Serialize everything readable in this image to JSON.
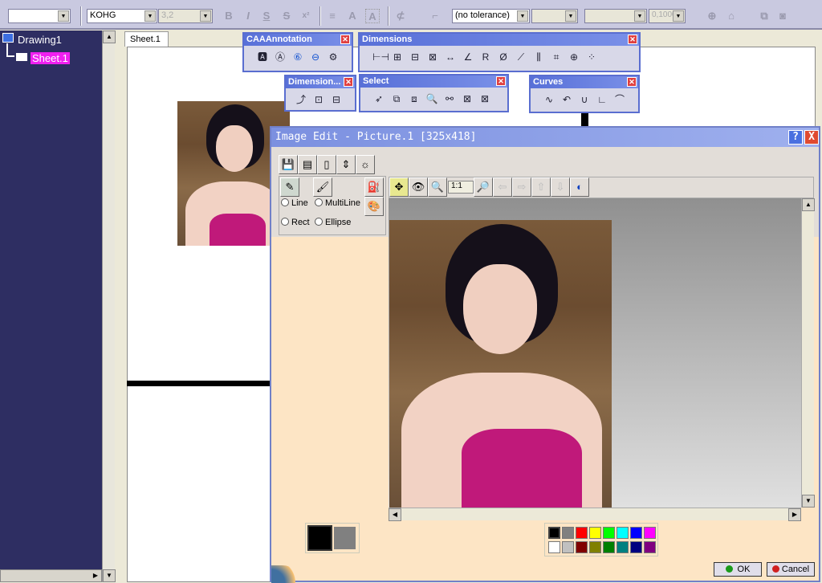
{
  "toolbar": {
    "font_name": "KOHG",
    "font_size": "3,2",
    "bold": "B",
    "italic": "I",
    "underline": "S",
    "strike": "S",
    "superscript": "x²",
    "tolerance": "(no tolerance)",
    "precision": "0,1000"
  },
  "tree": {
    "root": "Drawing1",
    "child": "Sheet.1"
  },
  "sheet_tab": "Sheet.1",
  "toolbars": {
    "caa": "CAAAnnotation",
    "dimensions": "Dimensions",
    "dimension2": "Dimension...",
    "select": "Select",
    "curves": "Curves"
  },
  "dialog": {
    "title": "Image Edit - Picture.1  [325x418]",
    "help": "?",
    "close": "X",
    "zoom_value": "1:1",
    "shapes": [
      "Line",
      "MultiLine",
      "Rect",
      "Ellipse"
    ],
    "ok": "OK",
    "cancel": "Cancel"
  },
  "colors": {
    "foreground": "#000000",
    "background": "#808080",
    "palette": [
      "#000000",
      "#808080",
      "#ff0000",
      "#ffff00",
      "#00ff00",
      "#00ffff",
      "#0000ff",
      "#ff00ff",
      "#ffffff",
      "#c0c0c0",
      "#800000",
      "#808000",
      "#008000",
      "#008080",
      "#000080",
      "#800080"
    ]
  }
}
